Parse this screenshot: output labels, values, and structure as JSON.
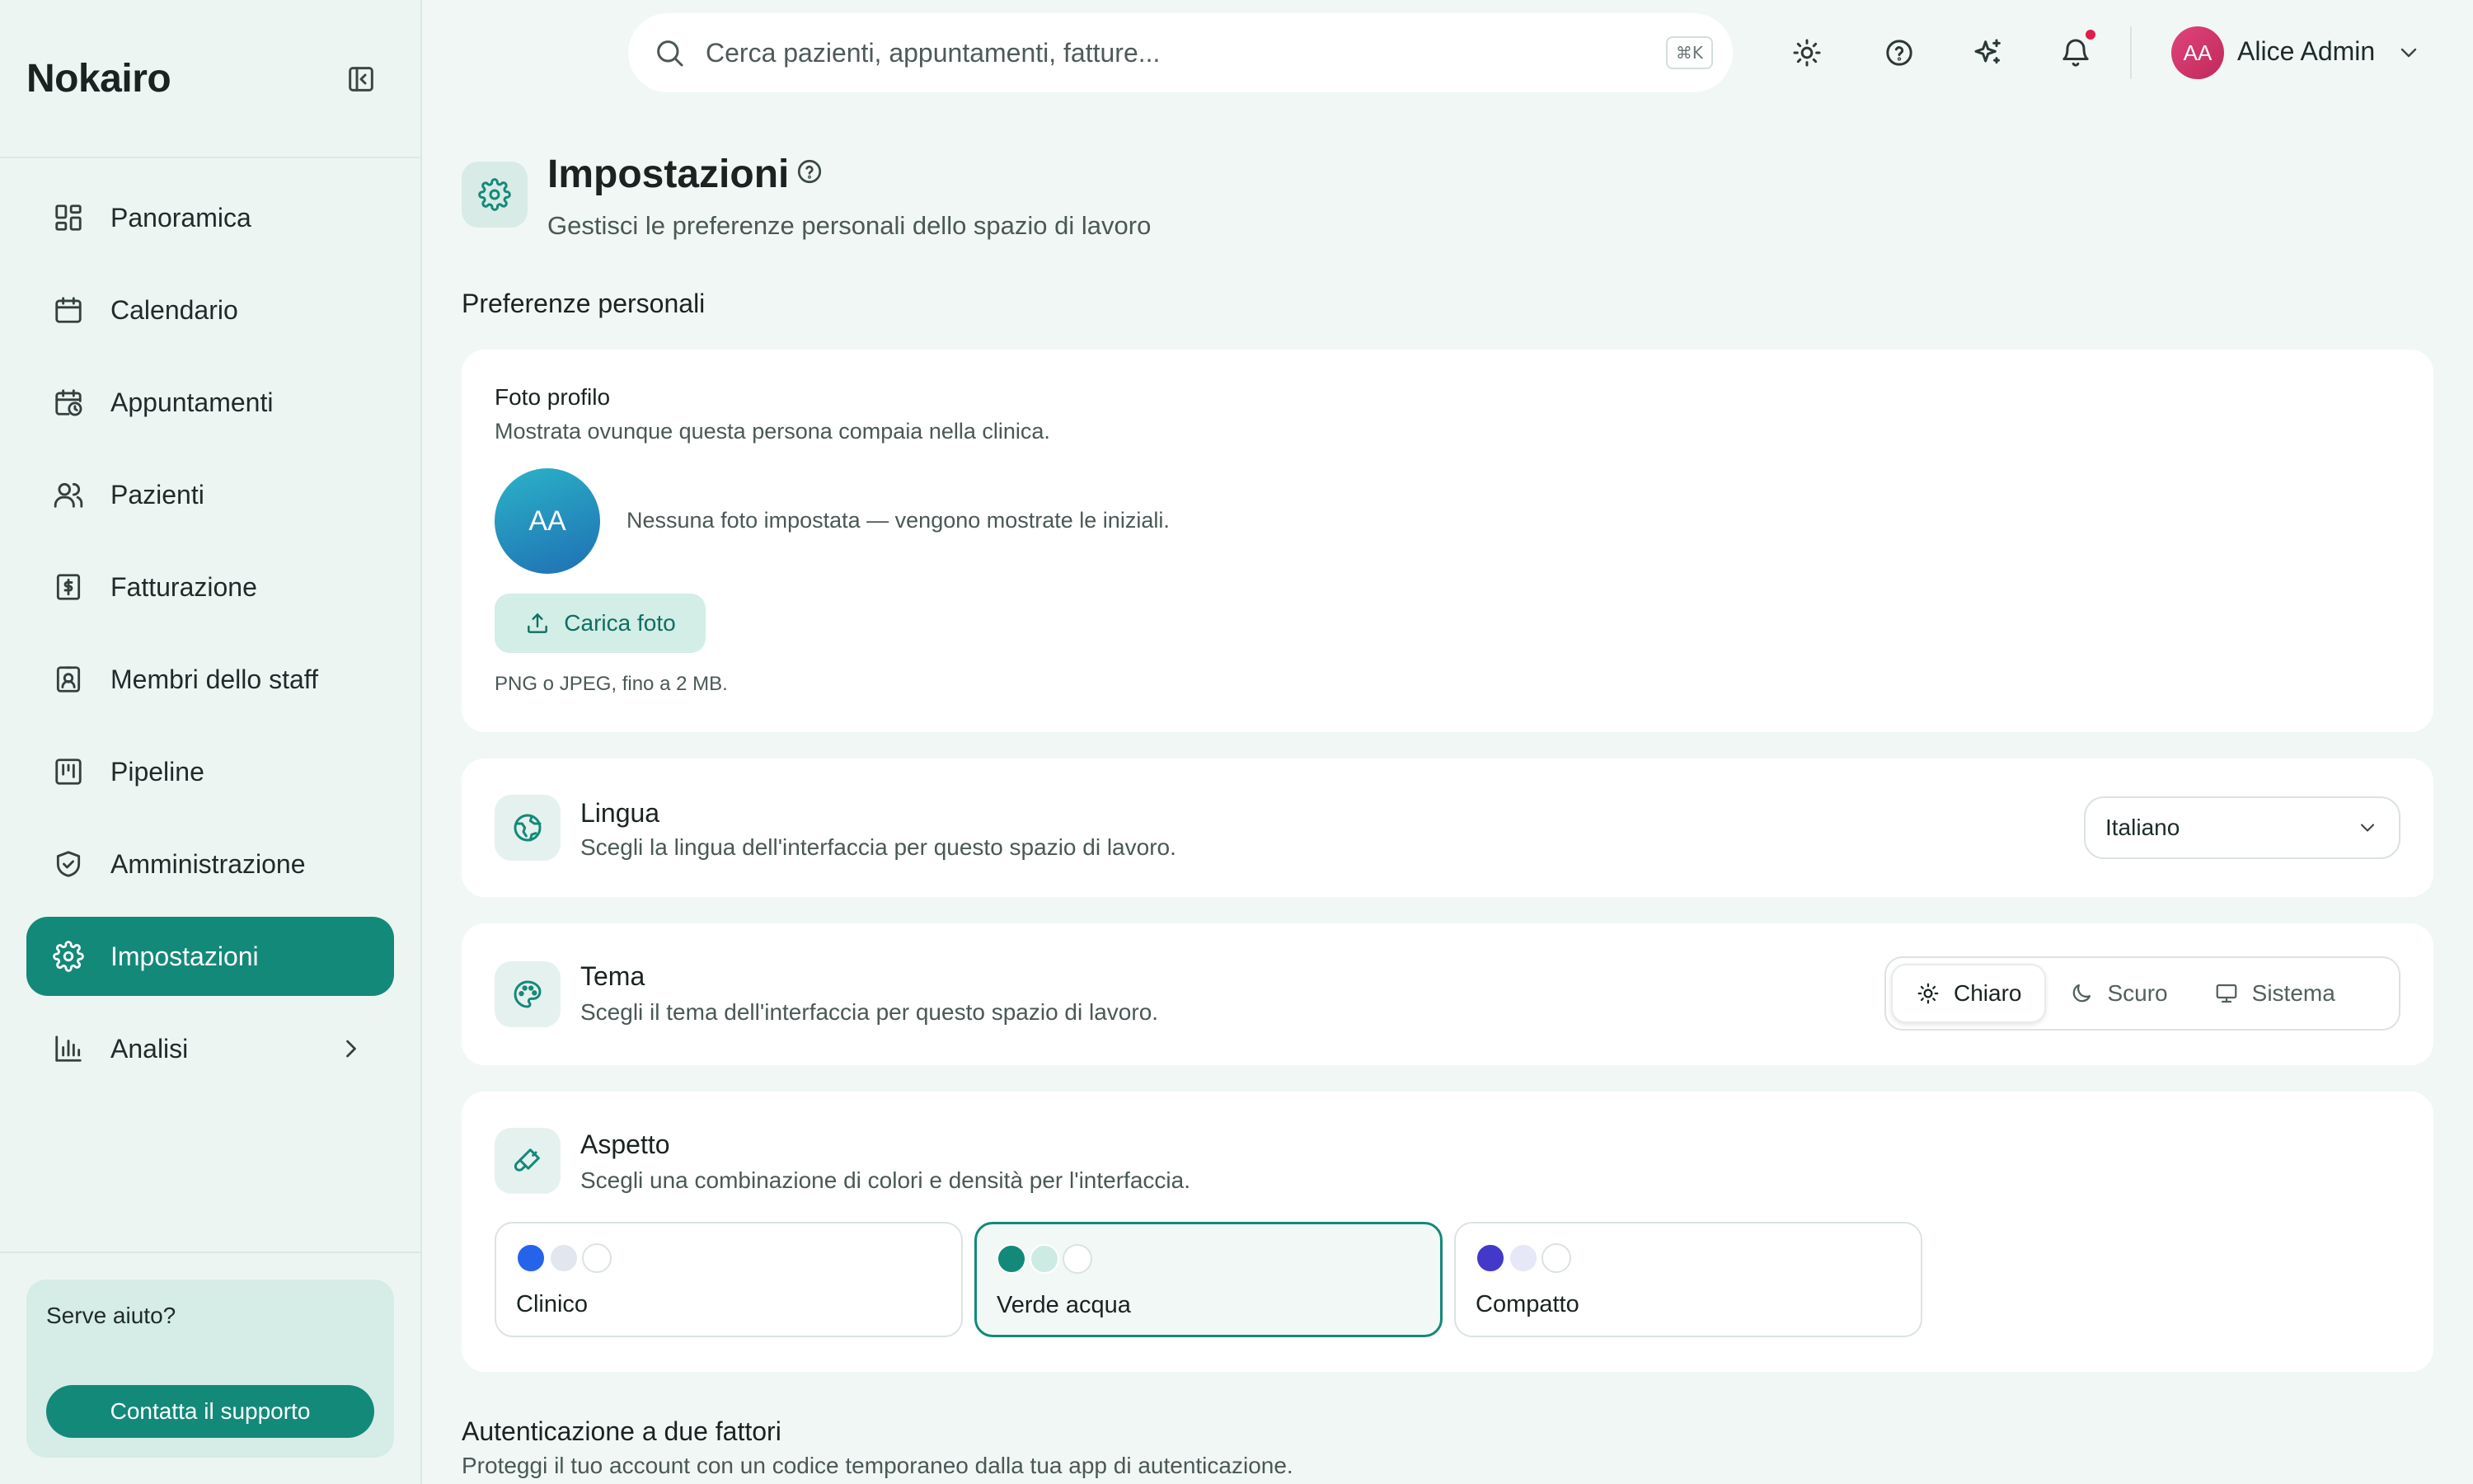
{
  "app": {
    "brand": "Nokairo"
  },
  "sidebar": {
    "items": [
      {
        "label": "Panoramica",
        "icon": "dashboard-icon"
      },
      {
        "label": "Calendario",
        "icon": "calendar-icon"
      },
      {
        "label": "Appuntamenti",
        "icon": "calendar-clock-icon"
      },
      {
        "label": "Pazienti",
        "icon": "users-icon"
      },
      {
        "label": "Fatturazione",
        "icon": "receipt-dollar-icon"
      },
      {
        "label": "Membri dello staff",
        "icon": "id-badge-icon"
      },
      {
        "label": "Pipeline",
        "icon": "kanban-icon"
      },
      {
        "label": "Amministrazione",
        "icon": "shield-check-icon"
      },
      {
        "label": "Impostazioni",
        "icon": "gear-icon",
        "active": true
      },
      {
        "label": "Analisi",
        "icon": "bar-chart-icon"
      }
    ],
    "help": {
      "title": "Serve aiuto?",
      "button": "Contatta il supporto"
    }
  },
  "topbar": {
    "search_placeholder": "Cerca pazienti, appuntamenti, fatture...",
    "shortcut": "⌘K",
    "user": {
      "initials": "AA",
      "name": "Alice Admin"
    }
  },
  "page": {
    "title": "Impostazioni",
    "subtitle": "Gestisci le preferenze personali dello spazio di lavoro",
    "section_title": "Preferenze personali"
  },
  "profile_photo": {
    "label": "Foto profilo",
    "description": "Mostrata ovunque questa persona compaia nella clinica.",
    "initials": "AA",
    "status": "Nessuna foto impostata — vengono mostrate le iniziali.",
    "upload_label": "Carica foto",
    "hint": "PNG o JPEG, fino a 2 MB."
  },
  "language": {
    "title": "Lingua",
    "description": "Scegli la lingua dell'interfaccia per questo spazio di lavoro.",
    "selected": "Italiano"
  },
  "theme": {
    "title": "Tema",
    "description": "Scegli il tema dell'interfaccia per questo spazio di lavoro.",
    "options": [
      {
        "label": "Chiaro",
        "icon": "sun-icon",
        "active": true
      },
      {
        "label": "Scuro",
        "icon": "moon-icon",
        "active": false
      },
      {
        "label": "Sistema",
        "icon": "monitor-icon",
        "active": false
      }
    ]
  },
  "appearance": {
    "title": "Aspetto",
    "description": "Scegli una combinazione di colori e densità per l'interfaccia.",
    "options": [
      {
        "label": "Clinico",
        "colors": [
          "#2563eb",
          "#e2e6ef",
          "#ffffff"
        ],
        "active": false
      },
      {
        "label": "Verde acqua",
        "colors": [
          "#13897a",
          "#cdeae3",
          "#ffffff"
        ],
        "active": true
      },
      {
        "label": "Compatto",
        "colors": [
          "#4338ca",
          "#e6e7f7",
          "#ffffff"
        ],
        "active": false
      }
    ]
  },
  "twofa": {
    "title": "Autenticazione a due fattori",
    "description": "Proteggi il tuo account con un codice temporaneo dalla tua app di autenticazione."
  },
  "colors": {
    "accent": "#13897a",
    "notification": "#e11d48",
    "background": "#f1f7f5"
  }
}
